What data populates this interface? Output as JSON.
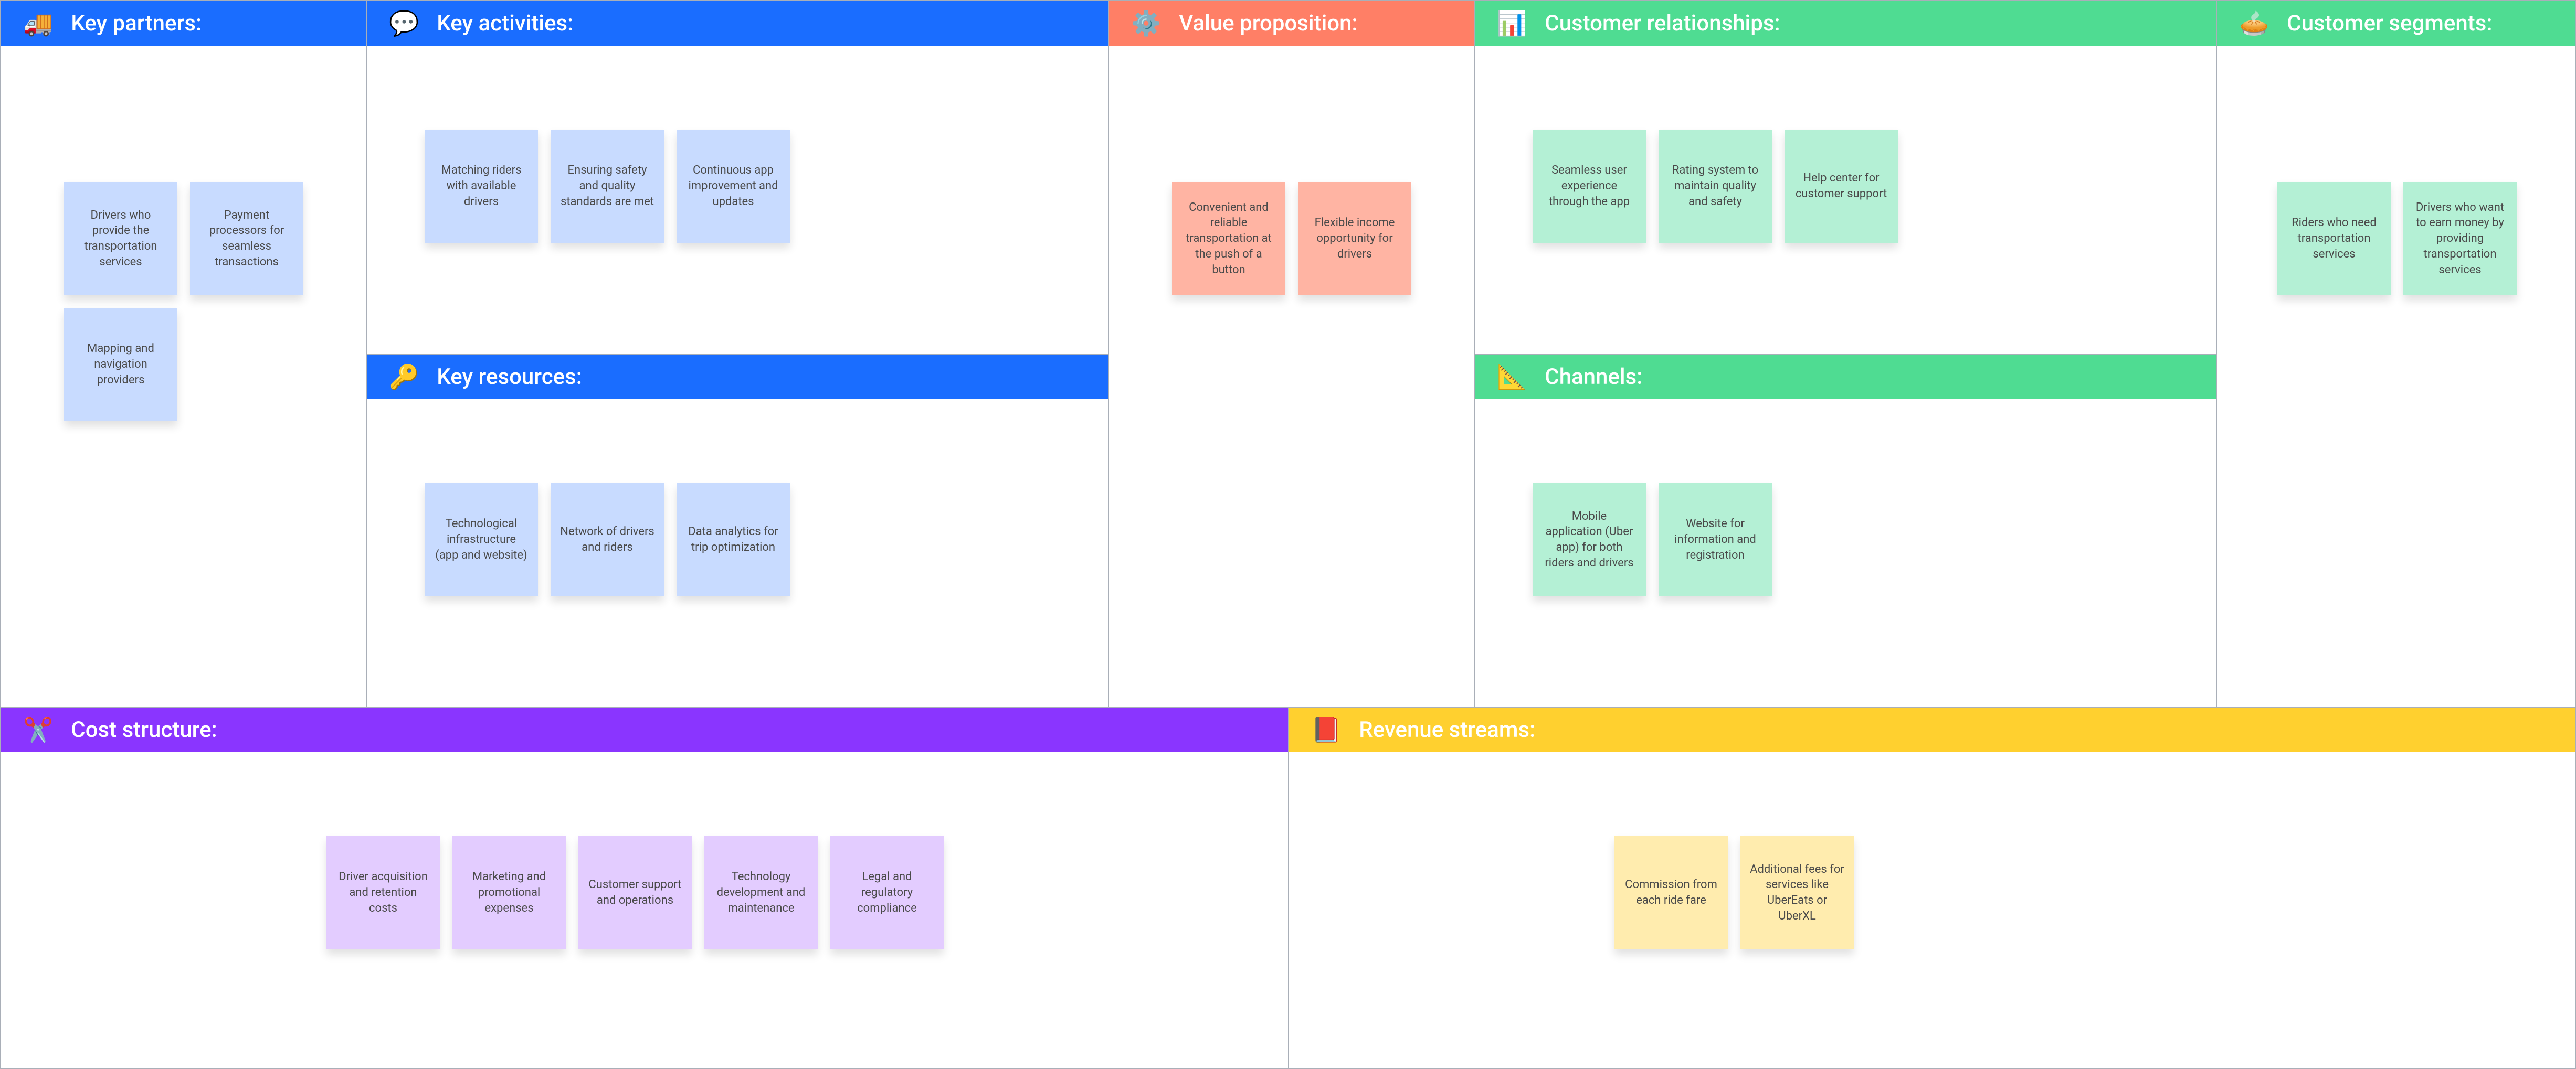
{
  "blocks": {
    "key_partners": {
      "title": "Key partners:",
      "icon": "🚚",
      "stickies": [
        "Drivers who provide the transportation services",
        "Payment processors for seamless transactions",
        "Mapping and navigation providers"
      ]
    },
    "key_activities": {
      "title": "Key activities:",
      "icon": "💬",
      "stickies": [
        "Matching riders with available drivers",
        "Ensuring safety and quality standards are met",
        "Continuous app improvement and updates"
      ]
    },
    "key_resources": {
      "title": "Key resources:",
      "icon": "🔑",
      "stickies": [
        "Technological infrastructure (app and website)",
        "Network of drivers and riders",
        "Data analytics for trip optimization"
      ]
    },
    "value_proposition": {
      "title": "Value proposition:",
      "icon": "⚙️",
      "stickies": [
        "Convenient and reliable transportation at the push of a button",
        "Flexible income opportunity for drivers"
      ]
    },
    "customer_relationships": {
      "title": "Customer relationships:",
      "icon": "📊",
      "stickies": [
        "Seamless user experience through the app",
        "Rating system to maintain quality and safety",
        "Help center for customer support"
      ]
    },
    "channels": {
      "title": "Channels:",
      "icon": "📐",
      "stickies": [
        "Mobile application (Uber app) for both riders and drivers",
        "Website for information and registration"
      ]
    },
    "customer_segments": {
      "title": "Customer segments:",
      "icon": "🥧",
      "stickies": [
        "Riders who need transportation services",
        "Drivers who want to earn money by providing transportation services"
      ]
    },
    "cost_structure": {
      "title": "Cost structure:",
      "icon": "✂️",
      "stickies": [
        "Driver acquisition and retention costs",
        "Marketing and promotional expenses",
        "Customer support and operations",
        "Technology development and maintenance",
        "Legal and regulatory compliance"
      ]
    },
    "revenue_streams": {
      "title": "Revenue streams:",
      "icon": "📕",
      "stickies": [
        "Commission from each ride fare",
        "Additional fees for services like UberEats or UberXL"
      ]
    }
  }
}
